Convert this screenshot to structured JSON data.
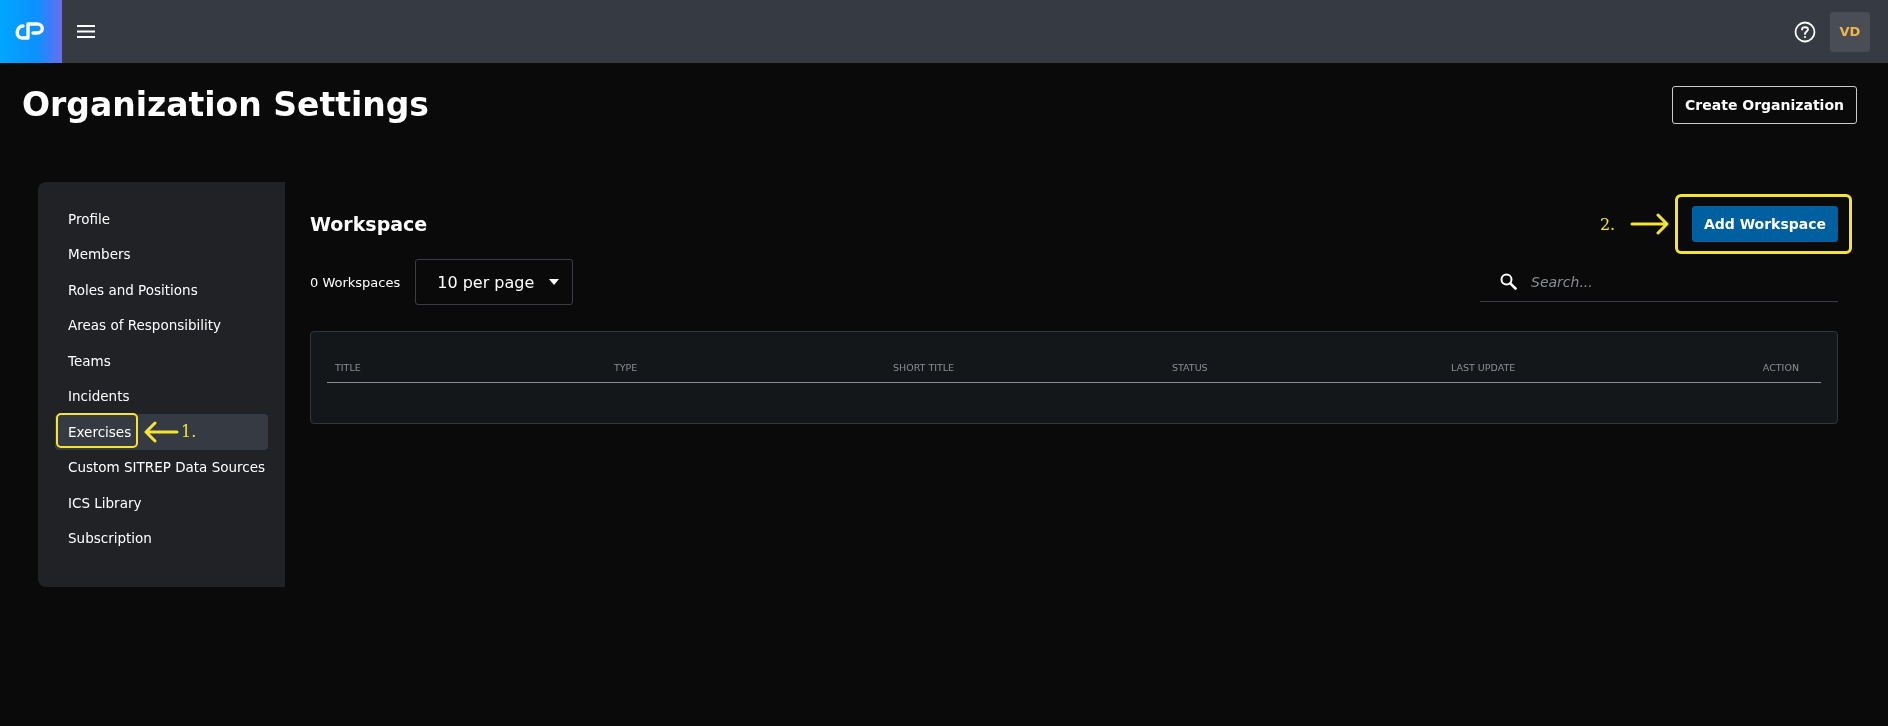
{
  "header": {
    "avatar": "VD"
  },
  "page_title": "Organization Settings",
  "create_button": "Create Organization",
  "sidebar": {
    "items": [
      {
        "label": "Profile",
        "selected": false
      },
      {
        "label": "Members",
        "selected": false
      },
      {
        "label": "Roles and Positions",
        "selected": false
      },
      {
        "label": "Areas of Responsibility",
        "selected": false
      },
      {
        "label": "Teams",
        "selected": false
      },
      {
        "label": "Incidents",
        "selected": false
      },
      {
        "label": "Exercises",
        "selected": true,
        "callout": "1."
      },
      {
        "label": "Custom SITREP Data Sources",
        "selected": false
      },
      {
        "label": "ICS Library",
        "selected": false
      },
      {
        "label": "Subscription",
        "selected": false
      }
    ]
  },
  "main": {
    "title": "Workspace",
    "add_button": {
      "label": "Add Workspace",
      "callout": "2."
    },
    "count": "0 Workspaces",
    "per_page": "10 per page",
    "search": {
      "placeholder": "Search..."
    },
    "table": {
      "columns": [
        "TITLE",
        "TYPE",
        "SHORT TITLE",
        "STATUS",
        "LAST UPDATE",
        "ACTION"
      ]
    }
  }
}
